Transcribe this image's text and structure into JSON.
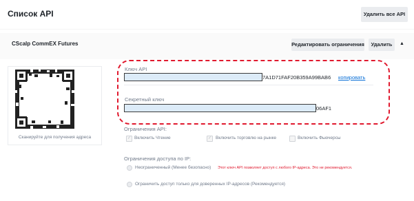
{
  "header": {
    "title": "Список API",
    "delete_all_label": "Удалить все API"
  },
  "api_entry": {
    "name": "CScalp CommEX Futures",
    "edit_label": "Редактировать ограничения",
    "delete_label": "Удалить",
    "qr_caption": "Сканируйте для получения адреса",
    "api_key_label": "Ключ API",
    "api_key_visible_tail": "7A1D71FAF20B359A99BAB6",
    "copy_label": "копировать",
    "secret_key_label": "Секретный ключ",
    "secret_key_visible_tail": "06AF1",
    "restrictions_label": "Ограничения API:",
    "permissions": [
      {
        "label": "Включить Чтение",
        "checked": true
      },
      {
        "label": "Включить торговлю на рынке",
        "checked": true
      },
      {
        "label": "Включить Фьючерсы",
        "checked": false
      }
    ],
    "ip_label": "Ограничения доступа по IP:",
    "ip_options": [
      {
        "label": "Неограниченный (Менее безопасно)",
        "warning": "Этот ключ API позволяет доступ с любого IP-адреса. Это не рекомендуется.",
        "selected": true
      },
      {
        "label": "Ограничить доступ только для доверенных IP-адресов (Рекомендуется)",
        "selected": false
      }
    ]
  },
  "colors": {
    "accent_link": "#0a6fd6",
    "highlight": "#e0182d",
    "warning": "#e0182d"
  }
}
